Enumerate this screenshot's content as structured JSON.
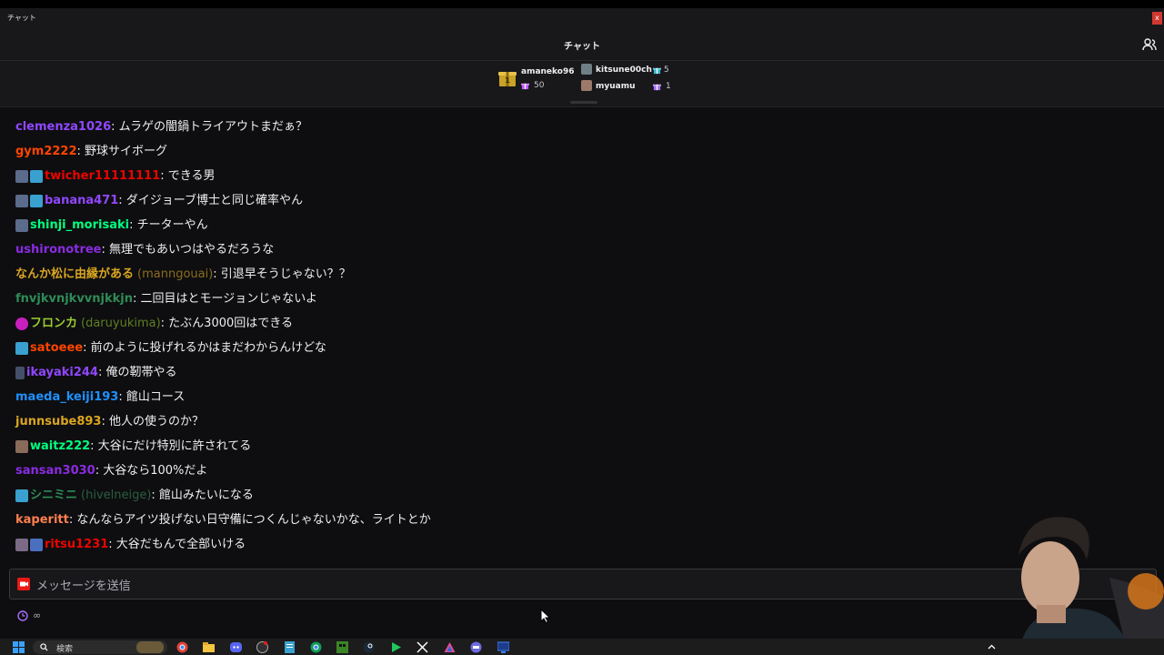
{
  "window": {
    "title": "チャット",
    "close": "x"
  },
  "header": {
    "title": "チャット"
  },
  "leaderboard": {
    "top": {
      "name": "amaneko96",
      "count": "50"
    },
    "second": {
      "name": "kitsune00ch",
      "count": "5"
    },
    "third": {
      "name": "myuamu",
      "count": "1"
    }
  },
  "messages": [
    {
      "user": "clemenza1026",
      "text": ": ムラゲの闇鍋トライアウトまだぁ？",
      "color": "#9147ff"
    },
    {
      "user": "gym2222",
      "text": ": 野球サイボーグ",
      "color": "#ff4500"
    },
    {
      "user": "twicher11111111",
      "text": ": できる男",
      "color": "#eb0400"
    },
    {
      "user": "banana471",
      "text": ": ダイジョーブ博士と同じ確率やん",
      "color": "#9147ff"
    },
    {
      "user": "shinji_morisaki",
      "text": ": チーターやん",
      "color": "#00ff7f"
    },
    {
      "user": "ushironotree",
      "text": ": 無理でもあいつはやるだろうな",
      "color": "#8a2be2"
    },
    {
      "user": "なんか松に由縁がある",
      "login": "(manngouai)",
      "text": ": 引退早そうじゃない？？",
      "color": "#daa520"
    },
    {
      "user": "fnvjkvnjkvvnjkkjn",
      "text": ": 二回目はとモージョンじゃないよ",
      "color": "#2e8b57"
    },
    {
      "user": "フロンカ",
      "login": "(daruyukima)",
      "text": ": たぶん3000回はできる",
      "color": "#9acd32"
    },
    {
      "user": "satoeee",
      "text": ": 前のように投げれるかはまだわからんけどな",
      "color": "#ff4500"
    },
    {
      "user": "ikayaki244",
      "text": ": 俺の靭帯やる",
      "color": "#9147ff"
    },
    {
      "user": "maeda_keiji193",
      "text": ": 館山コース",
      "color": "#1e90ff"
    },
    {
      "user": "junnsube893",
      "text": ": 他人の使うのか？",
      "color": "#daa520"
    },
    {
      "user": "waitz222",
      "text": ": 大谷にだけ特別に許されてる",
      "color": "#00ff7f"
    },
    {
      "user": "sansan3030",
      "text": ": 大谷なら100%だよ",
      "color": "#8a2be2"
    },
    {
      "user": "シニミニ",
      "login": "(hivelneige)",
      "text": ": 館山みたいになる",
      "color": "#2e8b57"
    },
    {
      "user": "kaperitt",
      "text": ": なんならアイツ投げない日守備につくんじゃないかな、ライトとか",
      "color": "#ff7f50"
    },
    {
      "user": "ritsu1231",
      "text": ": 大谷だもんで全部いける",
      "color": "#eb0400"
    }
  ],
  "input": {
    "placeholder": "メッセージを送信"
  },
  "footer": {
    "text": "∞"
  },
  "taskbar": {
    "search_label": "検索"
  }
}
